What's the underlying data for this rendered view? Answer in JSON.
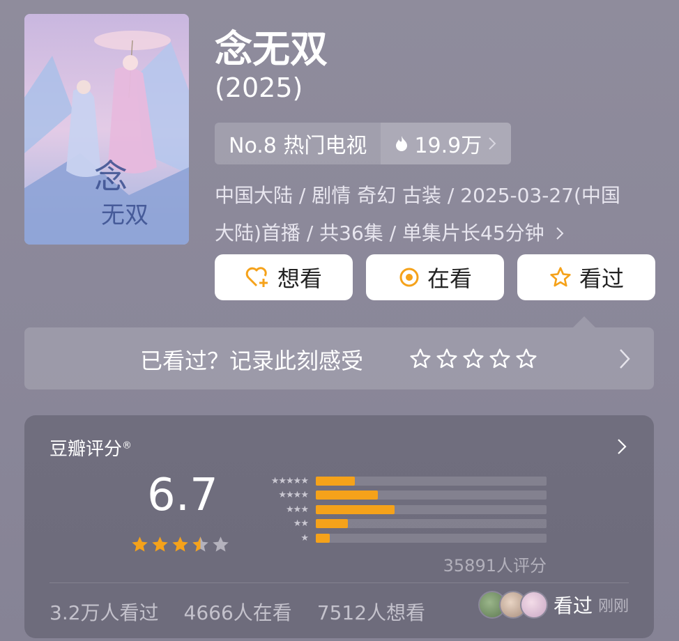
{
  "show": {
    "title": "念无双",
    "year": "(2025)",
    "rank_label": "No.8 热门电视",
    "heat": "19.9万",
    "meta_line1": "中国大陆 / 剧情 奇幻 古装 / 2025-03-27(中国",
    "meta_line2": "大陆)首播 / 共36集 / 单集片长45分钟"
  },
  "actions": {
    "want": "想看",
    "watching": "在看",
    "watched": "看过"
  },
  "record": {
    "prompt": "已看过？记录此刻感受"
  },
  "rating": {
    "title": "豆瓣评分",
    "registered_mark": "®",
    "score": "6.7",
    "stars": 3.5,
    "distribution": [
      {
        "stars": "★★★★★",
        "fraction": 0.17
      },
      {
        "stars": "★★★★",
        "fraction": 0.27
      },
      {
        "stars": "★★★",
        "fraction": 0.34
      },
      {
        "stars": "★★",
        "fraction": 0.14
      },
      {
        "stars": "★",
        "fraction": 0.06
      }
    ],
    "count_text": "35891人评分"
  },
  "stats": {
    "watched": "3.2万人看过",
    "watching": "4666人在看",
    "want": "7512人想看"
  },
  "recent": {
    "label": "看过",
    "time": "刚刚"
  },
  "colors": {
    "accent_orange": "#f5a21a",
    "background": "#8a8799"
  }
}
